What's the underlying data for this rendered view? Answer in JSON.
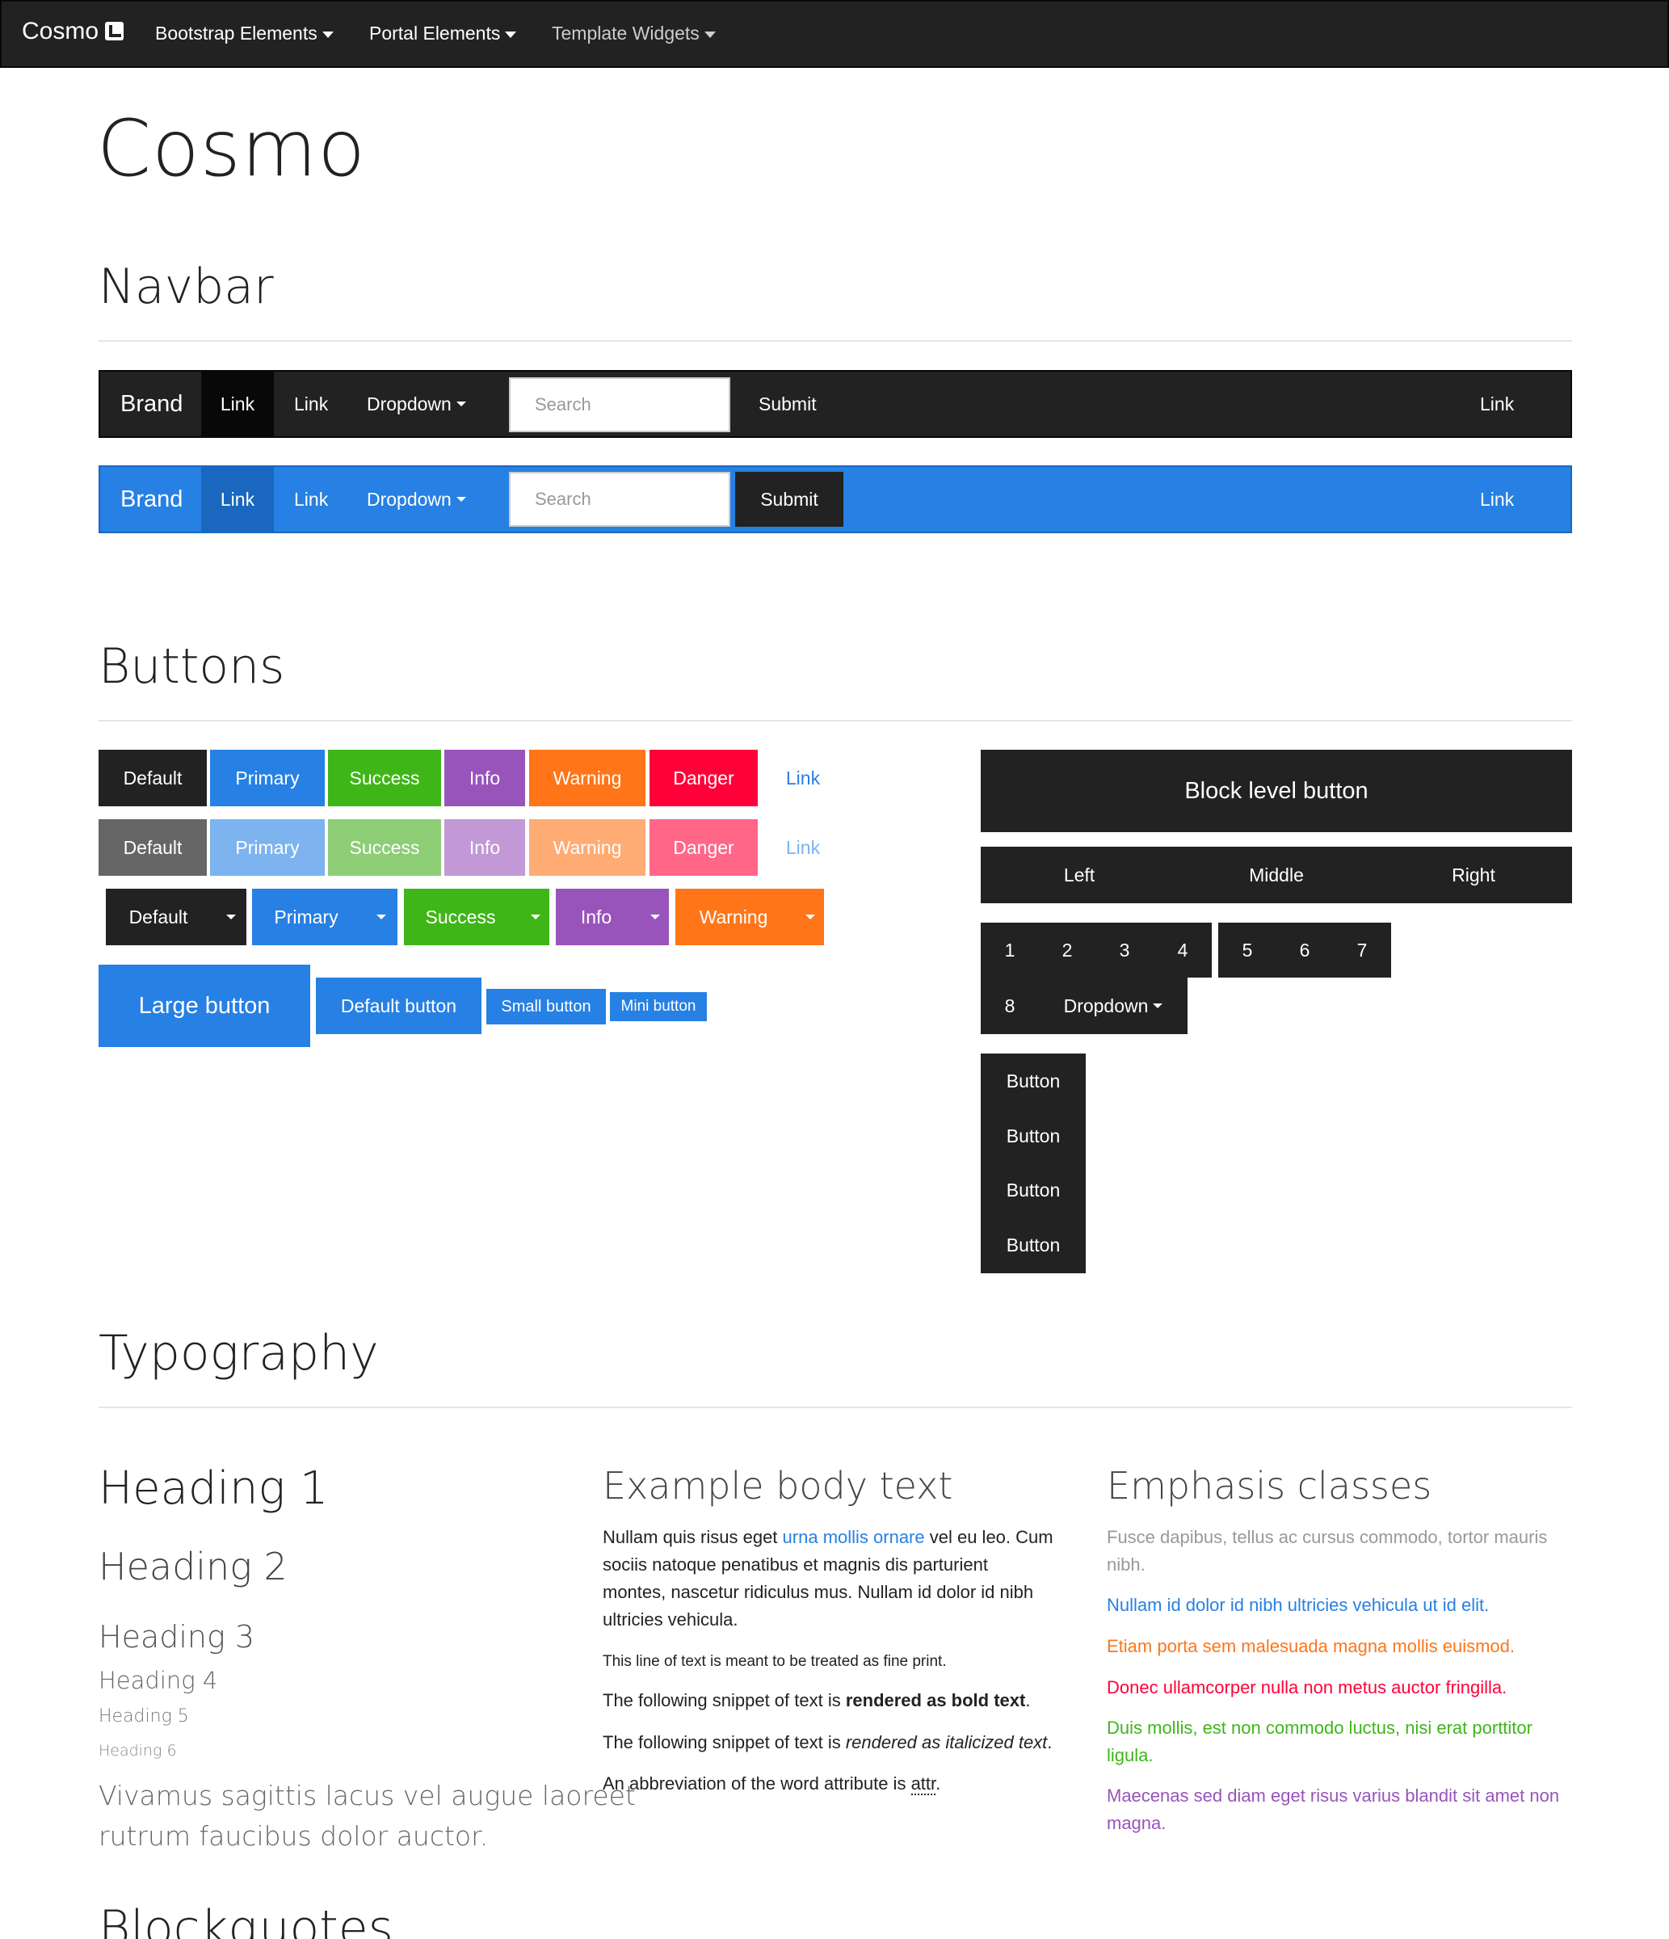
{
  "topnav": {
    "brand": "Cosmo",
    "items": [
      "Bootstrap Elements",
      "Portal Elements",
      "Template Widgets"
    ]
  },
  "page_title": "Cosmo",
  "sections": {
    "navbar": "Navbar",
    "buttons": "Buttons",
    "typography": "Typography",
    "blockquotes": "Blockquotes"
  },
  "navbars": {
    "brand": "Brand",
    "link_active": "Link",
    "link": "Link",
    "dropdown": "Dropdown",
    "search_placeholder": "Search",
    "submit": "Submit",
    "right_link": "Link"
  },
  "colors": {
    "default": "#222222",
    "primary": "#2780e3",
    "success": "#3fb618",
    "info": "#9954bb",
    "warning": "#ff7518",
    "danger": "#ff0039"
  },
  "buttons": {
    "row1": [
      "Default",
      "Primary",
      "Success",
      "Info",
      "Warning",
      "Danger",
      "Link"
    ],
    "row2": [
      "Default",
      "Primary",
      "Success",
      "Info",
      "Warning",
      "Danger",
      "Link"
    ],
    "row3": [
      "Default",
      "Primary",
      "Success",
      "Info",
      "Warning"
    ],
    "sizes": [
      "Large button",
      "Default button",
      "Small button",
      "Mini button"
    ],
    "block": "Block level button",
    "justified": [
      "Left",
      "Middle",
      "Right"
    ],
    "group1": [
      "1",
      "2",
      "3",
      "4"
    ],
    "group2": [
      "5",
      "6",
      "7"
    ],
    "group3": [
      "8",
      "Dropdown"
    ],
    "vertical": [
      "Button",
      "Button",
      "Button",
      "Button"
    ]
  },
  "typography": {
    "h1": "Heading 1",
    "h2": "Heading 2",
    "h3": "Heading 3",
    "h4": "Heading 4",
    "h5": "Heading 5",
    "h6": "Heading 6",
    "lead": [
      "Vivamus sagittis lacus vel augue laoreet",
      "rutrum faucibus dolor auctor."
    ],
    "body_heading": "Example body text",
    "para1_a": "Nullam quis risus eget ",
    "para1_link": "urna mollis ornare",
    "para1_b": " vel eu leo. Cum",
    "para1_lines": [
      "sociis natoque penatibus et magnis dis parturient",
      "montes, nascetur ridiculus mus. Nullam id dolor id nibh",
      "ultricies vehicula."
    ],
    "fine_print": "This line of text is meant to be treated as fine print.",
    "bold_a": "The following snippet of text is ",
    "bold_b": "rendered as bold text",
    "bold_c": ".",
    "italic_a": "The following snippet of text is ",
    "italic_b": "rendered as italicized text",
    "italic_c": ".",
    "abbr_a": "An abbreviation of the word attribute is ",
    "abbr_b": "attr",
    "abbr_c": ".",
    "emph_heading": "Emphasis classes",
    "muted": [
      "Fusce dapibus, tellus ac cursus commodo, tortor mauris",
      "nibh."
    ],
    "primary": "Nullam id dolor id nibh ultricies vehicula ut id elit.",
    "warning": "Etiam porta sem malesuada magna mollis euismod.",
    "danger": "Donec ullamcorper nulla non metus auctor fringilla.",
    "success": [
      "Duis mollis, est non commodo luctus, nisi erat porttitor",
      "ligula."
    ],
    "info": [
      "Maecenas sed diam eget risus varius blandit sit amet non",
      "magna."
    ]
  }
}
